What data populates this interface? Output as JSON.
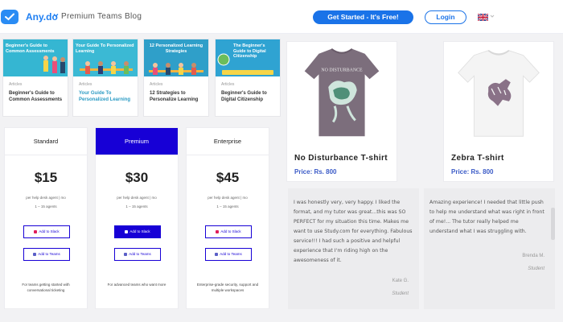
{
  "header": {
    "brand": "Any.do",
    "blog_title": "Premium Teams Blog",
    "get_started_label": "Get Started - It's Free!",
    "login_label": "Login"
  },
  "blog_cards": [
    {
      "thumb_title": "Beginner's Guide to Common Assessments",
      "category": "Articles",
      "title": "Beginner's Guide to Common Assessments",
      "thumb_color": "#35b6d2"
    },
    {
      "thumb_title": "Your Guide To Personalized Learning",
      "category": "Articles",
      "title": "Your Guide To Personalized Learning",
      "thumb_color": "#3bb9d4"
    },
    {
      "thumb_title": "12 Personalized Learning Strategies",
      "category": "Articles",
      "title": "12 Strategies to Personalize Learning",
      "thumb_color": "#2f9fc9"
    },
    {
      "thumb_title": "The Beginner's Guide to Digital Citizenship",
      "category": "Articles",
      "title": "Beginner's Guide to Digital Citizenship",
      "thumb_color": "#2fa3d2"
    }
  ],
  "pricing": [
    {
      "plan": "Standard",
      "price": "$15",
      "unit": "per help desk agent | mo",
      "agents": "1 – 15 agents",
      "slack_label": "Add to Slack",
      "teams_label": "Add to Teams",
      "desc": "For teams getting started with conversational ticketing"
    },
    {
      "plan": "Premium",
      "price": "$30",
      "unit": "per help desk agent | mo",
      "agents": "1 – 15 agents",
      "slack_label": "Add to Slack",
      "teams_label": "Add to Teams",
      "desc": "For advanced teams who want more"
    },
    {
      "plan": "Enterprise",
      "price": "$45",
      "unit": "per help desk agent | mo",
      "agents": "1 – 15 agents",
      "slack_label": "Add to Slack",
      "teams_label": "Add to Teams",
      "desc": "Enterprise-grade security, support and multiple workspaces"
    }
  ],
  "products": [
    {
      "name": "No Disturbance T-shirt",
      "price": "Price: Rs. 800",
      "shirt_color": "#7c6e7c",
      "print_text": "NO DISTURBANCE"
    },
    {
      "name": "Zebra T-shirt",
      "price": "Price: Rs. 800",
      "shirt_color": "#f4f4f4"
    }
  ],
  "testimonials": [
    {
      "text": "I was honestly very, very happy. I liked the format, and my tutor was great...this was SO PERFECT for my situation this time. Makes me want to use Study.com for everything. Fabulous service!!! I had such a positive and helpful experience that I'm riding high on the awesomeness of it.",
      "author": "Kate G.",
      "role": "Student"
    },
    {
      "text": "Amazing experience! I needed that little push to help me understand what was right in front of me!... The tutor really helped me understand what I was struggling with.",
      "author": "Brenda M.",
      "role": "Student"
    }
  ],
  "colors": {
    "accent": "#1a73e8",
    "premium": "#1700d6",
    "price_blue": "#3b5bc7"
  }
}
